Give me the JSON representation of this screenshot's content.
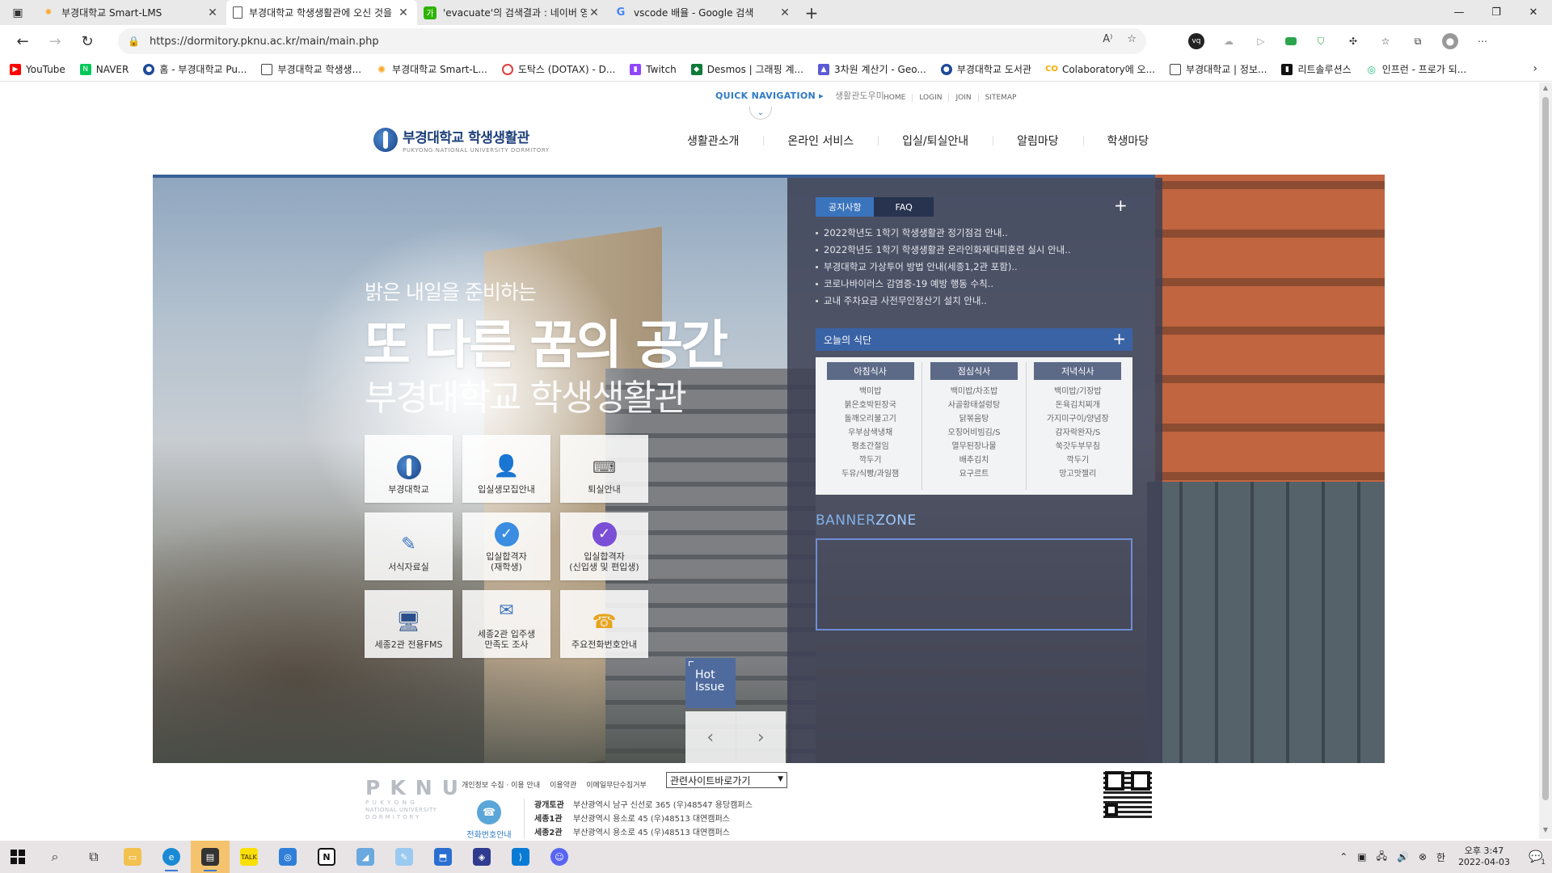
{
  "browser": {
    "tabs": [
      {
        "title": "부경대학교 Smart-LMS",
        "active": false,
        "icon_color": "#f6a623"
      },
      {
        "title": "부경대학교 학생생활관에 오신 것을",
        "active": true,
        "icon_color": "#ffffff"
      },
      {
        "title": "'evacuate'의 검색결과 : 네이버 영",
        "active": false,
        "icon_color": "#2db400"
      },
      {
        "title": "vscode 배율 - Google 검색",
        "active": false,
        "icon_color": "#4285f4"
      }
    ],
    "url": "https://dormitory.pknu.ac.kr/main/main.php",
    "bookmarks": [
      {
        "label": "YouTube",
        "color": "#ff0000"
      },
      {
        "label": "NAVER",
        "color": "#03c75a"
      },
      {
        "label": "홈 - 부경대학교 Pu...",
        "color": "#1d4a9a"
      },
      {
        "label": "부경대학교 학생생...",
        "color": "#ffffff"
      },
      {
        "label": "부경대학교 Smart-L...",
        "color": "#f6a623"
      },
      {
        "label": "도탁스 (DOTAX) - D...",
        "color": "#e03e3e"
      },
      {
        "label": "Twitch",
        "color": "#9146ff"
      },
      {
        "label": "Desmos | 그래핑 계...",
        "color": "#127a3a"
      },
      {
        "label": "3차원 계산기 - Geo...",
        "color": "#5b5bd6"
      },
      {
        "label": "부경대학교 도서관",
        "color": "#1d4a9a"
      },
      {
        "label": "Colaboratory에 오...",
        "color": "#f9ab00"
      },
      {
        "label": "부경대학교 | 정보...",
        "color": "#ffffff"
      },
      {
        "label": "리트솔루션스",
        "color": "#111111"
      },
      {
        "label": "인프런 - 프로가 되...",
        "color": "#1dc078"
      }
    ]
  },
  "site": {
    "quick_nav": "QUICK NAVIGATION ▸",
    "helper": "생활관도우미",
    "top_links": [
      "HOME",
      "LOGIN",
      "JOIN",
      "SITEMAP"
    ],
    "logo_kor": "부경대학교 학생생활관",
    "logo_eng": "PUKYONG NATIONAL UNIVERSITY DORMITORY",
    "gnb": [
      "생활관소개",
      "온라인 서비스",
      "입실/퇴실안내",
      "알림마당",
      "학생마당"
    ],
    "slogan1": "밝은 내일을 준비하는",
    "slogan2": "또 다른 꿈의 공간",
    "slogan3": "부경대학교 학생생활관",
    "quick_menu": [
      {
        "label": "부경대학교"
      },
      {
        "label": "입실생모집안내"
      },
      {
        "label": "퇴실안내"
      },
      {
        "label": "서식자료실"
      },
      {
        "label": "입실합격자\n(재학생)"
      },
      {
        "label": "입실합격자\n(신입생 및 편입생)"
      },
      {
        "label": "세종2관 전용FMS"
      },
      {
        "label": "세종2관 입주생\n만족도 조사"
      },
      {
        "label": "주요전화번호안내"
      }
    ],
    "hot_issue": "Hot Issue",
    "notice_tabs": [
      "공지사항",
      "FAQ"
    ],
    "notices": [
      "2022학년도 1학기 학생생활관 정기점검 안내..",
      "2022학년도 1학기 학생생활관 온라인화재대피훈련 실시 안내..",
      "부경대학교 가상투어 방법 안내(세종1,2관 포함)..",
      "코로나바이러스 감염증-19 예방 행동 수칙..",
      "교내 주차요금 사전무인정산기 설치 안내.."
    ],
    "meal_title": "오늘의 식단",
    "meals": [
      {
        "name": "아침식사",
        "items": [
          "백미밥",
          "붉은호박된장국",
          "돌깨오리불고기",
          "우부삼색냉채",
          "평초간절임",
          "깍두기",
          "두유/식빵/과일잼"
        ]
      },
      {
        "name": "점심식사",
        "items": [
          "백미밥/차조밥",
          "사골황태설렁탕",
          "닭볶음탕",
          "오징어비빔김/S",
          "열무된장나물",
          "배추김치",
          "요구르트"
        ]
      },
      {
        "name": "저녁식사",
        "items": [
          "백미밥/기장밥",
          "돈육김치찌개",
          "가지미구이/양념장",
          "감자락완자/S",
          "쑥갓두부무침",
          "깍두기",
          "망고맛젤리"
        ]
      }
    ],
    "banner_title_a": "BANNER",
    "banner_title_b": "ZONE",
    "footer": {
      "logo_big": "PKNU",
      "logo_small": [
        "PUKYONG",
        "NATIONAL UNIVERSITY",
        "DORMITORY"
      ],
      "links": [
        "개인정보 수집 · 이용 안내",
        "이용약관",
        "이메일무단수집거부"
      ],
      "select": "관련사이트바로가기",
      "phone_label": "전화번호안내",
      "addresses": [
        {
          "name": "광개토관",
          "addr": "부산광역시 남구 신선로 365 (우)48547 용당캠퍼스"
        },
        {
          "name": "세종1관",
          "addr": "부산광역시 용소로 45 (우)48513 대연캠퍼스"
        },
        {
          "name": "세종2관",
          "addr": "부산광역시 용소로 45 (우)48513 대연캠퍼스"
        }
      ]
    }
  },
  "taskbar": {
    "clock_time": "오후 3:47",
    "clock_date": "2022-04-03",
    "ime": "한",
    "notify_count": "1"
  }
}
